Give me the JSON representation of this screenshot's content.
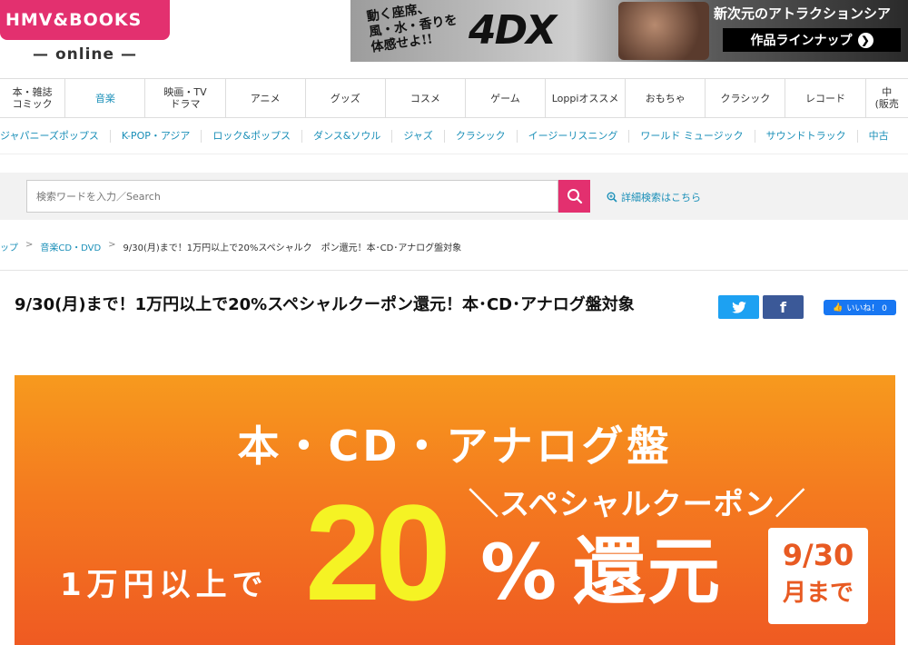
{
  "brand": {
    "logo_line1": "HMV&BOOKS",
    "logo_line2": "— online —"
  },
  "ad": {
    "catch": "動く座席、\n風・水・香りを\n体感せよ!!",
    "logo": "4DX",
    "headline": "新次元のアトラクションシア",
    "button": "作品ラインナップ",
    "button_icon": "chevron-right-icon"
  },
  "nav": [
    {
      "label": "本・雑誌\nコミック",
      "active": false
    },
    {
      "label": "音楽",
      "active": true
    },
    {
      "label": "映画・TV\nドラマ",
      "active": false
    },
    {
      "label": "アニメ",
      "active": false
    },
    {
      "label": "グッズ",
      "active": false
    },
    {
      "label": "コスメ",
      "active": false
    },
    {
      "label": "ゲーム",
      "active": false
    },
    {
      "label": "Loppiオススメ",
      "active": false
    },
    {
      "label": "おもちゃ",
      "active": false
    },
    {
      "label": "クラシック",
      "active": false
    },
    {
      "label": "レコード",
      "active": false
    },
    {
      "label": "中\n(販売",
      "active": false
    }
  ],
  "subnav": [
    "ジャパニーズポップス",
    "K-POP・アジア",
    "ロック&ポップス",
    "ダンス&ソウル",
    "ジャズ",
    "クラシック",
    "イージーリスニング",
    "ワールド ミュージック",
    "サウンドトラック",
    "中古"
  ],
  "search": {
    "placeholder": "検索ワードを入力／Search",
    "button_icon": "search-icon",
    "advanced_label": "詳細検索はこちら"
  },
  "breadcrumb": [
    "ップ",
    "音楽CD・DVD",
    "9/30(月)まで！1万円以上で20%スペシャルク　ポン還元！本･CD･アナログ盤対象"
  ],
  "article": {
    "title": "9/30(月)まで！1万円以上で20%スペシャルクーポン還元！本･CD･アナログ盤対象",
    "share": {
      "twitter_icon": "twitter-icon",
      "facebook_icon": "facebook-icon",
      "like_label": "いいね！ 0"
    }
  },
  "promo": {
    "line1": "本・CD・アナログ盤",
    "line2": "＼スペシャルクーポン／",
    "line3": "1万円以上で",
    "big_number": "20",
    "percent": "%",
    "kanji": "還元",
    "date_top": "9/30",
    "date_bottom": "月まで",
    "colors": {
      "accent": "#f5f324",
      "bg_top": "#f79a1e",
      "bg_bottom": "#ef5a22"
    }
  }
}
